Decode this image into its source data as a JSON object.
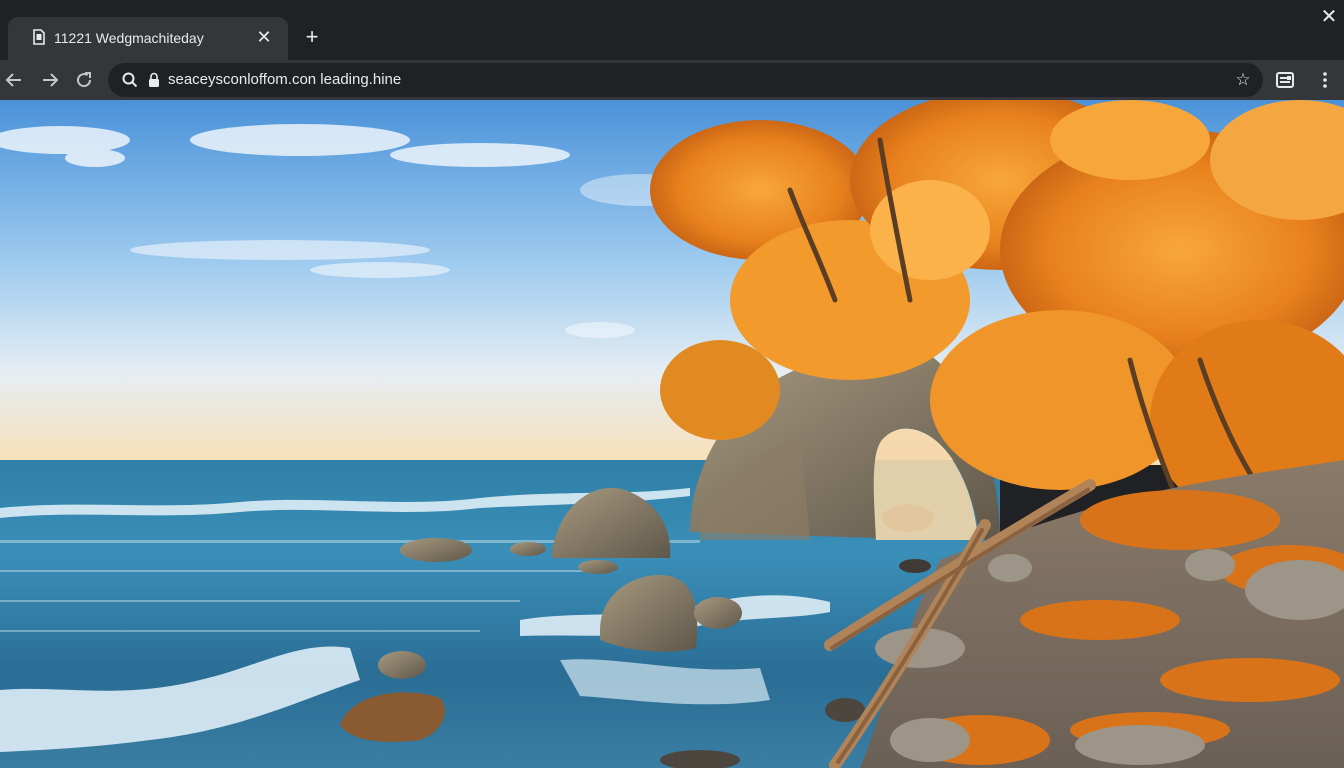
{
  "browser": {
    "tab": {
      "title": "11221 Wedgmachiteday",
      "favicon_icon": "document-icon",
      "close_icon": "close-icon"
    },
    "new_tab_icon": "plus-icon",
    "window_close_icon": "close-icon",
    "toolbar": {
      "back_icon": "arrow-left-icon",
      "forward_icon": "arrow-right-icon",
      "reload_icon": "reload-icon",
      "search_icon": "search-icon",
      "lock_icon": "lock-icon",
      "url": "seaceysconloffom.con leading.hine",
      "bookmark_icon": "star-icon",
      "reading_mode_icon": "reading-list-icon",
      "menu_icon": "kebab-menu-icon"
    }
  },
  "colors": {
    "tabstrip_bg": "#202124",
    "toolbar_bg": "#35363a",
    "text": "#e8eaed"
  },
  "page": {
    "image_description_icon": "coastal-autumn-landscape"
  }
}
